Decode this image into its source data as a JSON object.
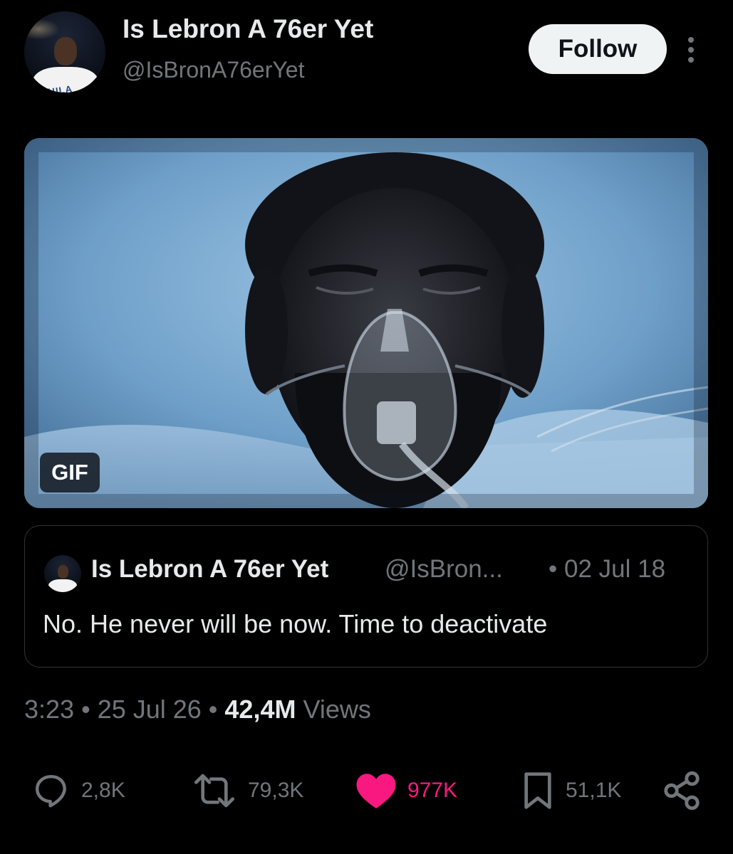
{
  "author": {
    "display_name": "Is Lebron A 76er Yet",
    "handle": "@IsBronA76erYet",
    "avatar_jersey_text": "PHILA"
  },
  "follow_label": "Follow",
  "media": {
    "badge": "GIF"
  },
  "quote": {
    "display_name": "Is Lebron A 76er Yet",
    "handle": "@IsBron...",
    "date": "• 02 Jul 18",
    "text": "No. He never will be now. Time to deactivate"
  },
  "meta": {
    "time": "3:23",
    "sep1": " • ",
    "date": "25 Jul 26",
    "sep2": " • ",
    "views_count": "42,4M",
    "views_label": " Views"
  },
  "actions": {
    "replies": "2,8K",
    "reposts": "79,3K",
    "likes": "977K",
    "bookmarks": "51,1K"
  },
  "colors": {
    "background": "#000000",
    "like": "#f91880",
    "muted": "#71767b",
    "border": "#2f3336"
  },
  "icons": [
    "more-vertical-icon",
    "reply-icon",
    "repost-icon",
    "like-icon",
    "bookmark-icon",
    "share-icon"
  ]
}
